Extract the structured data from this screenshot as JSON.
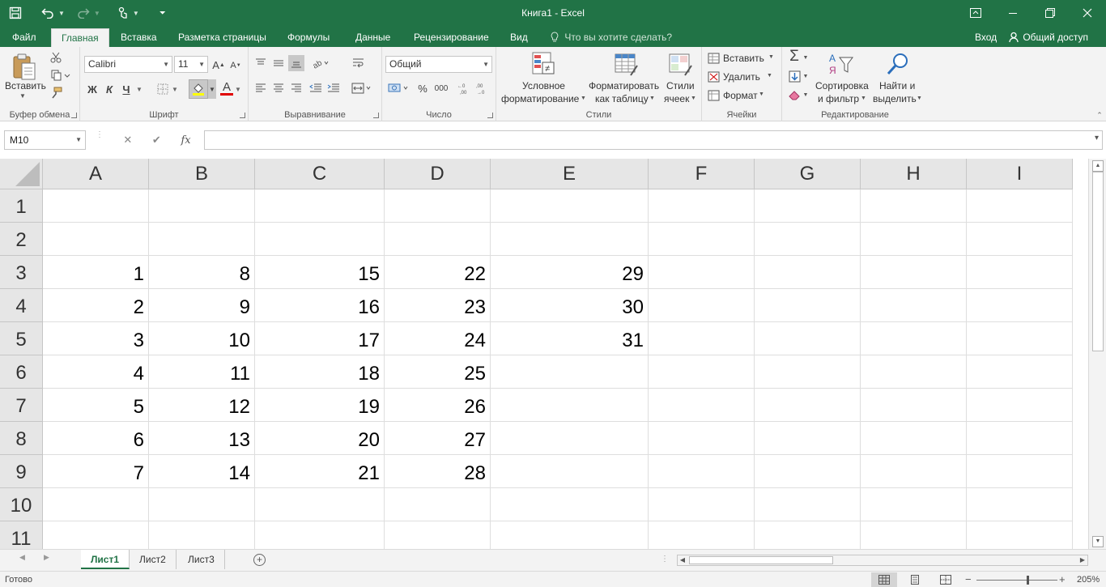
{
  "app": {
    "title": "Книга1 - Excel",
    "colors": {
      "accent": "#217346",
      "ribbon_bg": "#f3f3f3",
      "grid_line": "#dedede"
    },
    "icons": {
      "save": "save-icon",
      "undo": "undo-icon",
      "redo": "redo-icon",
      "touch": "touch-mode-icon",
      "customize": "customize-qat-icon"
    }
  },
  "window": {
    "restore_ribbon": "▭",
    "minimize": "—",
    "maximize": "❐",
    "close": "✕"
  },
  "tabs": [
    {
      "label": "Файл"
    },
    {
      "label": "Главная"
    },
    {
      "label": "Вставка"
    },
    {
      "label": "Разметка страницы"
    },
    {
      "label": "Формулы"
    },
    {
      "label": "Данные"
    },
    {
      "label": "Рецензирование"
    },
    {
      "label": "Вид"
    }
  ],
  "active_tab": "Главная",
  "tellme": "Что вы хотите сделать?",
  "signin": "Вход",
  "share": "Общий доступ",
  "ribbon": {
    "clipboard": {
      "label": "Буфер обмена",
      "paste": "Вставить"
    },
    "font": {
      "label": "Шрифт",
      "font_name": "Calibri",
      "font_size": "11",
      "bold": "Ж",
      "italic": "К",
      "underline": "Ч",
      "grow": "A",
      "shrink": "A",
      "color_a": "A"
    },
    "alignment": {
      "label": "Выравнивание"
    },
    "number": {
      "label": "Число",
      "format": "Общий",
      "percent": "%",
      "thousands": "000"
    },
    "styles": {
      "label": "Стили",
      "conditional_1": "Условное",
      "conditional_2": "форматирование",
      "table_1": "Форматировать",
      "table_2": "как таблицу",
      "cell_1": "Стили",
      "cell_2": "ячеек"
    },
    "cells": {
      "label": "Ячейки",
      "insert": "Вставить",
      "delete": "Удалить",
      "format": "Формат"
    },
    "editing": {
      "label": "Редактирование",
      "sort_1": "Сортировка",
      "sort_2": "и фильтр",
      "find_1": "Найти и",
      "find_2": "выделить",
      "sigma": "Σ"
    }
  },
  "formula_bar": {
    "name_box": "M10",
    "cancel": "✕",
    "enter": "✔",
    "fx": "fx",
    "formula": ""
  },
  "columns": [
    "A",
    "B",
    "C",
    "D",
    "E",
    "F",
    "G",
    "H",
    "I"
  ],
  "rows": [
    "1",
    "2",
    "3",
    "4",
    "5",
    "6",
    "7",
    "8",
    "9",
    "10",
    "11"
  ],
  "cells": [
    [
      "",
      "",
      "",
      "",
      "",
      "",
      "",
      "",
      ""
    ],
    [
      "",
      "",
      "",
      "",
      "",
      "",
      "",
      "",
      ""
    ],
    [
      "1",
      "8",
      "15",
      "22",
      "29",
      "",
      "",
      "",
      ""
    ],
    [
      "2",
      "9",
      "16",
      "23",
      "30",
      "",
      "",
      "",
      ""
    ],
    [
      "3",
      "10",
      "17",
      "24",
      "31",
      "",
      "",
      "",
      ""
    ],
    [
      "4",
      "11",
      "18",
      "25",
      "",
      "",
      "",
      "",
      ""
    ],
    [
      "5",
      "12",
      "19",
      "26",
      "",
      "",
      "",
      "",
      ""
    ],
    [
      "6",
      "13",
      "20",
      "27",
      "",
      "",
      "",
      "",
      ""
    ],
    [
      "7",
      "14",
      "21",
      "28",
      "",
      "",
      "",
      "",
      ""
    ],
    [
      "",
      "",
      "",
      "",
      "",
      "",
      "",
      "",
      ""
    ],
    [
      "",
      "",
      "",
      "",
      "",
      "",
      "",
      "",
      ""
    ]
  ],
  "sheets": [
    {
      "label": "Лист1"
    },
    {
      "label": "Лист2"
    },
    {
      "label": "Лист3"
    }
  ],
  "active_sheet": "Лист1",
  "status": {
    "ready": "Готово",
    "zoom": "205%",
    "zoom_minus": "−",
    "zoom_plus": "+"
  }
}
